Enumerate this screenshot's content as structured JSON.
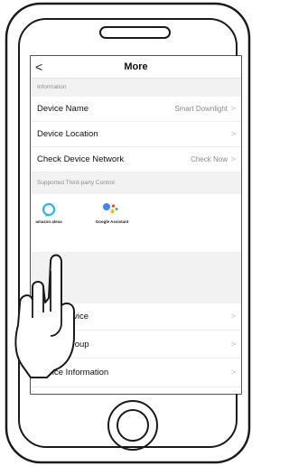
{
  "nav": {
    "back_glyph": "<",
    "title": "More"
  },
  "sections": {
    "information": "Information",
    "third_party": "Supported Third-party Control"
  },
  "info_rows": [
    {
      "label": "Device Name",
      "value": "Smart Downlight"
    },
    {
      "label": "Device Location",
      "value": ""
    },
    {
      "label": "Check Device Network",
      "value": "Check Now"
    }
  ],
  "partners": [
    {
      "label": "amazon alexa",
      "icon": "alexa-icon"
    },
    {
      "label": "Google Assistant",
      "icon": "google-assistant-icon"
    }
  ],
  "lower_rows": [
    {
      "label": "Share Device"
    },
    {
      "label": "Create Group"
    },
    {
      "label": "Device Information"
    }
  ],
  "colors": {
    "alexa_blue": "#29b6e8",
    "google_blue": "#4285f4",
    "google_red": "#ea4335",
    "google_yellow": "#fbbc05",
    "google_green": "#34a853"
  }
}
